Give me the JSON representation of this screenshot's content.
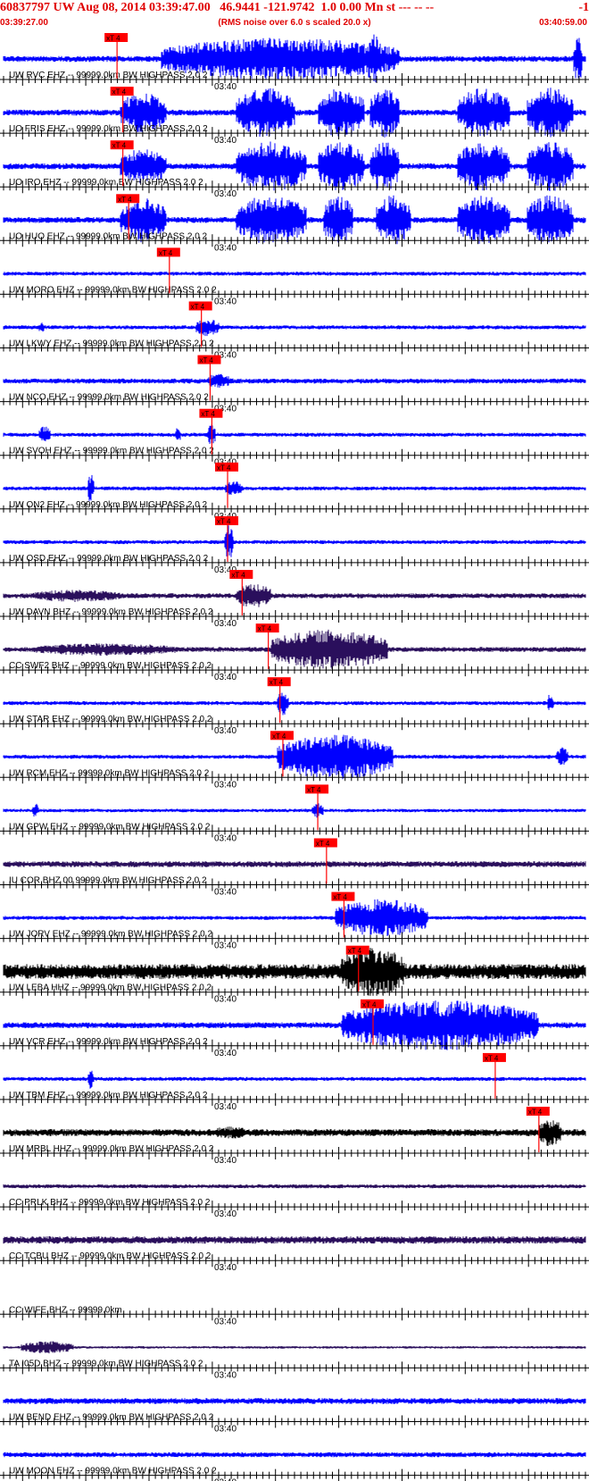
{
  "header": {
    "title": "60837797 UW Aug 08, 2014 03:39:47.00   46.9441 -121.9742  1.0 0.00 Mn st --- -- --",
    "code": "-1",
    "start_time": "03:39:27.00",
    "note": "(RMS noise over 6.0 s scaled 20.0 x)",
    "end_time": "03:40:59.00"
  },
  "colors": {
    "header_text": "#e00000",
    "trace_blue": "#0000ff",
    "trace_purple": "#2a0f5c",
    "trace_black": "#000000",
    "pick_red": "#ff0000",
    "axis": "#000000"
  },
  "chart_data": {
    "type": "line",
    "title": "60837797 UW Aug 08, 2014 03:39:47.00   46.9441 -121.9742  1.0 0.00 Mn st --- -- --  -1",
    "xlabel": "",
    "ylabel": "",
    "x_range": [
      "03:39:27.00",
      "03:40:59.00"
    ],
    "minute_tick": "03:40",
    "pick_label": "xT 4",
    "grid": false,
    "traces": [
      {
        "label": "UW RVC EHZ -- 99999.0km BW  HIGHPASS  2.0  2",
        "color": "blue",
        "pick_pct": 19.5,
        "bursts": [
          [
            27,
            68,
            0.85
          ],
          [
            62,
            65,
            1.0
          ],
          [
            98,
            99.5,
            1.0
          ]
        ],
        "amp": 0.12
      },
      {
        "label": "UO FRIS EHZ -- 99999.0km BW  HIGHPASS  2.0  2",
        "color": "blue",
        "pick_pct": 20.5,
        "bursts": [
          [
            20,
            28,
            0.8
          ],
          [
            40,
            50,
            1.0
          ],
          [
            54,
            62,
            1.0
          ],
          [
            63,
            68,
            1.0
          ],
          [
            78,
            87,
            1.0
          ],
          [
            90,
            98,
            1.0
          ]
        ],
        "amp": 0.12
      },
      {
        "label": "UO IRO EHZ -- 99999.0km BW  HIGHPASS  2.0  2",
        "color": "blue",
        "pick_pct": 20.5,
        "bursts": [
          [
            20,
            28,
            0.7
          ],
          [
            40,
            52,
            1.0
          ],
          [
            54,
            62,
            1.0
          ],
          [
            63,
            68,
            1.0
          ],
          [
            78,
            87,
            1.0
          ],
          [
            90,
            98,
            1.0
          ]
        ],
        "amp": 0.12
      },
      {
        "label": "UO HUO EHZ -- 99999.0km BW  HIGHPASS  2.0  2",
        "color": "blue",
        "pick_pct": 21.5,
        "bursts": [
          [
            20,
            28,
            0.9
          ],
          [
            40,
            52,
            1.0
          ],
          [
            55,
            60,
            1.0
          ],
          [
            64,
            70,
            1.0
          ],
          [
            78,
            87,
            1.0
          ],
          [
            90,
            98,
            1.0
          ]
        ],
        "amp": 0.12
      },
      {
        "label": "UW MORO EHZ -- 99999.0km BW  HIGHPASS  2.0  2",
        "color": "blue",
        "pick_pct": 28.5,
        "bursts": [],
        "amp": 0.08
      },
      {
        "label": "UW LKWY EHZ -- 99999.0km BW  HIGHPASS  2.0  2",
        "color": "blue",
        "pick_pct": 34.0,
        "bursts": [
          [
            33,
            37,
            0.35
          ],
          [
            6,
            7,
            0.25
          ]
        ],
        "amp": 0.08
      },
      {
        "label": "UW NCO EHZ -- 99999.0km BW  HIGHPASS  2.0  2",
        "color": "blue",
        "pick_pct": 35.5,
        "bursts": [
          [
            35,
            39,
            0.3
          ]
        ],
        "amp": 0.1
      },
      {
        "label": "UW SVOH EHZ -- 99999.0km BW  HIGHPASS  2.0  2",
        "color": "blue",
        "pick_pct": 35.8,
        "bursts": [
          [
            6,
            8,
            0.35
          ],
          [
            29.5,
            30.5,
            0.3
          ],
          [
            35,
            36.5,
            0.4
          ]
        ],
        "amp": 0.08
      },
      {
        "label": "UW ON2 EHZ -- 99999.0km BW  HIGHPASS  2.0  2",
        "color": "blue",
        "pick_pct": 38.5,
        "bursts": [
          [
            14.5,
            15.5,
            0.6
          ],
          [
            38,
            41,
            0.3
          ]
        ],
        "amp": 0.08
      },
      {
        "label": "UW OSD EHZ -- 99999.0km BW  HIGHPASS  2.0  2",
        "color": "blue",
        "pick_pct": 38.5,
        "bursts": [
          [
            38,
            39.5,
            0.7
          ]
        ],
        "amp": 0.08
      },
      {
        "label": "UW DAVN BHZ -- 99999.0km BW  HIGHPASS  2.0  2",
        "color": "purple",
        "pick_pct": 41.0,
        "bursts": [
          [
            5,
            20,
            0.25
          ],
          [
            40,
            46,
            0.5
          ]
        ],
        "amp": 0.1
      },
      {
        "label": "CC SWF2 BHZ -- 99999.0km BW  HIGHPASS  2.0  2",
        "color": "purple",
        "pick_pct": 45.5,
        "bursts": [
          [
            5,
            30,
            0.25
          ],
          [
            46,
            66,
            0.8
          ]
        ],
        "amp": 0.1
      },
      {
        "label": "UW STAR EHZ -- 99999.0km BW  HIGHPASS  2.0  2",
        "color": "blue",
        "pick_pct": 47.5,
        "bursts": [
          [
            47,
            49,
            0.5
          ],
          [
            93.5,
            94.5,
            0.4
          ]
        ],
        "amp": 0.08
      },
      {
        "label": "UW RCM EHZ -- 99999.0km BW  HIGHPASS  2.0  2",
        "color": "blue",
        "pick_pct": 48.0,
        "bursts": [
          [
            47,
            67,
            0.9
          ],
          [
            95,
            97,
            0.4
          ]
        ],
        "amp": 0.08
      },
      {
        "label": "UW GPW EHZ -- 99999.0km BW  HIGHPASS  2.0  2",
        "color": "blue",
        "pick_pct": 54.0,
        "bursts": [
          [
            5,
            6,
            0.3
          ],
          [
            53,
            55,
            0.3
          ]
        ],
        "amp": 0.07
      },
      {
        "label": "IU COR BHZ 00 99999.0km BW  HIGHPASS  2.0  2",
        "color": "purple",
        "pick_pct": 55.5,
        "bursts": [],
        "amp": 0.12
      },
      {
        "label": "UW JORV EHZ -- 99999.0km BW  HIGHPASS  2.0  2",
        "color": "blue",
        "pick_pct": 58.5,
        "bursts": [
          [
            57,
            73,
            0.75
          ]
        ],
        "amp": 0.08
      },
      {
        "label": "UW LEBA HHZ -- 99999.0km BW  HIGHPASS  2.0  2",
        "color": "black",
        "pick_pct": 61.0,
        "bursts": [
          [
            58,
            69,
            1.0
          ]
        ],
        "amp": 0.3
      },
      {
        "label": "UW VCR EHZ -- 99999.0km BW  HIGHPASS  2.0  2",
        "color": "blue",
        "pick_pct": 63.5,
        "bursts": [
          [
            58,
            92,
            1.0
          ]
        ],
        "amp": 0.12
      },
      {
        "label": "UW TBM EHZ -- 99999.0km BW  HIGHPASS  2.0  2",
        "color": "blue",
        "pick_pct": 84.5,
        "bursts": [
          [
            14.5,
            15.5,
            0.4
          ]
        ],
        "amp": 0.08
      },
      {
        "label": "UW MRBL HHZ -- 99999.0km BW  HIGHPASS  2.0  2",
        "color": "black",
        "pick_pct": 92.0,
        "bursts": [
          [
            92,
            96,
            0.55
          ],
          [
            36,
            42,
            0.25
          ]
        ],
        "amp": 0.14
      },
      {
        "label": "CC PRLK BHZ -- 99999.0km BW  HIGHPASS  2.0  2",
        "color": "purple",
        "pick_pct": null,
        "bursts": [],
        "amp": 0.08
      },
      {
        "label": "CC TCBU BHZ -- 99999.0km BW  HIGHPASS  2.0  2",
        "color": "purple",
        "pick_pct": null,
        "bursts": [],
        "amp": 0.15
      },
      {
        "label": "CC WIFE BHZ -- 99999.0km",
        "color": "none",
        "pick_pct": null,
        "bursts": [],
        "amp": 0
      },
      {
        "label": "TA I05D BHZ -- 99999.0km BW  HIGHPASS  2.0  2",
        "color": "purple",
        "pick_pct": null,
        "bursts": [
          [
            3,
            12,
            0.25
          ]
        ],
        "amp": 0.05
      },
      {
        "label": "UW BEND EHZ -- 99999.0km BW  HIGHPASS  2.0  2",
        "color": "blue",
        "pick_pct": null,
        "bursts": [],
        "amp": 0.12
      },
      {
        "label": "UW MOON EHZ -- 99999.0km BW  HIGHPASS  2.0  2",
        "color": "blue",
        "pick_pct": null,
        "bursts": [],
        "amp": 0.1
      }
    ]
  }
}
